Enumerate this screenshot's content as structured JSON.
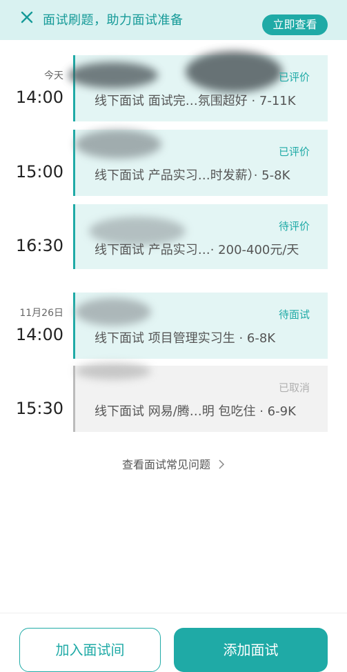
{
  "banner": {
    "title": "面试刷题，助力面试准备",
    "action_label": "立即查看",
    "close_icon": "close-icon"
  },
  "schedule": [
    {
      "day": "今天",
      "time": "14:00",
      "status": "已评价",
      "desc": "线下面试 面试完…氛围超好 · 7-11K",
      "cancelled": false
    },
    {
      "day": "",
      "time": "15:00",
      "status": "已评价",
      "desc": "线下面试 产品实习…时发薪）· 5-8K",
      "cancelled": false
    },
    {
      "day": "",
      "time": "16:30",
      "status": "待评价",
      "desc": "线下面试 产品实习…· 200-400元/天",
      "cancelled": false
    },
    {
      "day": "11月26日",
      "time": "14:00",
      "status": "待面试",
      "desc": "线下面试 项目管理实习生 · 6-8K",
      "cancelled": false
    },
    {
      "day": "",
      "time": "15:30",
      "status": "已取消",
      "desc": "线下面试 网易/腾…明 包吃住 · 6-9K",
      "cancelled": true
    }
  ],
  "faq_link": "查看面试常见问题",
  "buttons": {
    "join": "加入面试间",
    "add": "添加面试"
  },
  "colors": {
    "accent": "#1faaa6",
    "banner_bg": "#d9f2f1",
    "card_bg": "#e3f5f4",
    "cancel_bg": "#f2f2f2"
  }
}
